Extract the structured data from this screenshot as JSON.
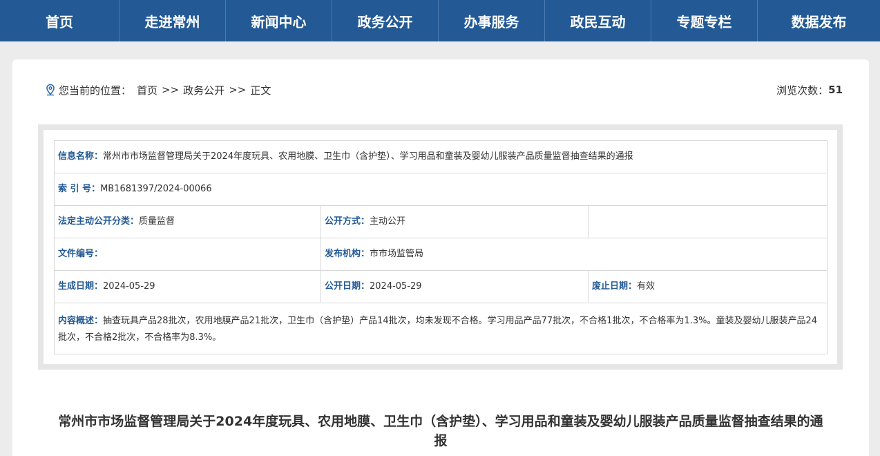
{
  "nav": [
    "首页",
    "走进常州",
    "新闻中心",
    "政务公开",
    "办事服务",
    "政民互动",
    "专题专栏",
    "数据发布"
  ],
  "breadcrumb": {
    "prefix": "您当前的位置：",
    "items": [
      "首页",
      "政务公开",
      "正文"
    ],
    "separator": ">>"
  },
  "views": {
    "label": "浏览次数：",
    "count": "51"
  },
  "info": {
    "name_label": "信息名称：",
    "name_value": "常州市市场监督管理局关于2024年度玩具、农用地膜、卫生巾（含护垫）、学习用品和童装及婴幼儿服装产品质量监督抽查结果的通报",
    "index_label": "索 引 号：",
    "index_value": "MB1681397/2024-00066",
    "category_label": "法定主动公开分类：",
    "category_value": "质量监督",
    "method_label": "公开方式：",
    "method_value": "主动公开",
    "docno_label": "文件编号：",
    "docno_value": "",
    "publisher_label": "发布机构：",
    "publisher_value": "市市场监管局",
    "created_label": "生成日期：",
    "created_value": "2024-05-29",
    "published_label": "公开日期：",
    "published_value": "2024-05-29",
    "expiry_label": "废止日期：",
    "expiry_value": "有效",
    "summary_label": "内容概述：",
    "summary_value": "抽查玩具产品28批次，农用地膜产品21批次，卫生巾（含护垫）产品14批次，均未发现不合格。学习用品产品77批次，不合格1批次，不合格率为1.3%。童装及婴幼儿服装产品24批次，不合格2批次，不合格率为8.3%。"
  },
  "article": {
    "title": "常州市市场监督管理局关于2024年度玩具、农用地膜、卫生巾（含护垫）、学习用品和童装及婴幼儿服装产品质量监督抽查结果的通报"
  },
  "colors": {
    "nav_bg": "#235a95",
    "label": "#235a95",
    "page_bg": "#ececec"
  }
}
